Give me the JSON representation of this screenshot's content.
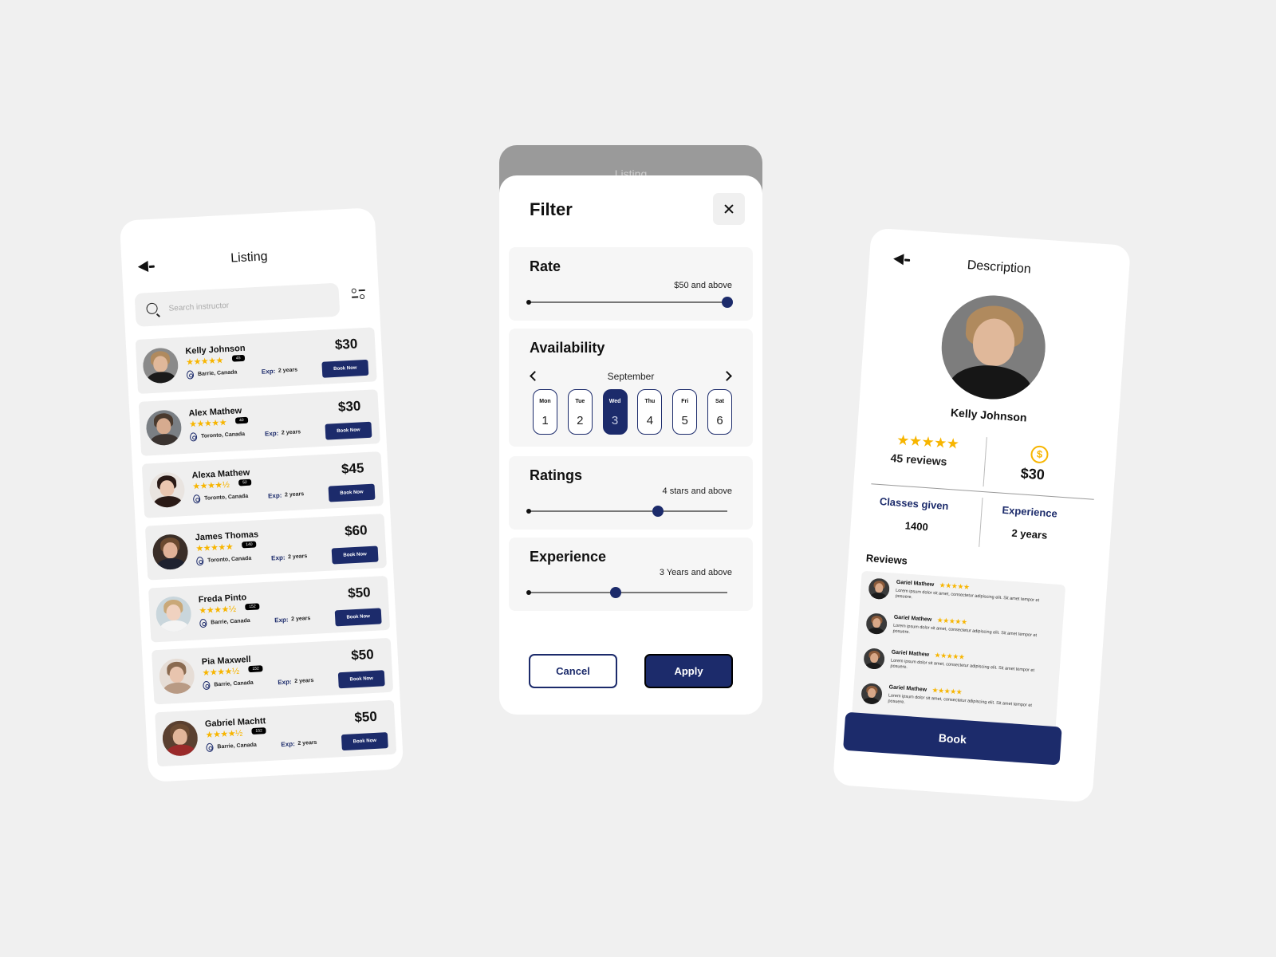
{
  "colors": {
    "brand_navy": "#1c2b6b",
    "star_yellow": "#f7b500",
    "background": "#f0f0f0"
  },
  "listing": {
    "title": "Listing",
    "back_icon": "back-arrow-icon",
    "search": {
      "placeholder": "Search instructor",
      "value": ""
    },
    "filter_icon": "filter-sliders-icon",
    "items": [
      {
        "name": "Kelly Johnson",
        "stars": "★★★★★",
        "rating": 5,
        "reviews": "45",
        "location": "Barrie, Canada",
        "exp_label": "Exp:",
        "exp": "2 years",
        "price": "$30",
        "button": "Book Now"
      },
      {
        "name": "Alex Mathew",
        "stars": "★★★★★",
        "rating": 5,
        "reviews": "40",
        "location": "Toronto, Canada",
        "exp_label": "Exp:",
        "exp": "2 years",
        "price": "$30",
        "button": "Book Now"
      },
      {
        "name": "Alexa Mathew",
        "stars": "★★★★½",
        "rating": 4.5,
        "reviews": "52",
        "location": "Toronto, Canada",
        "exp_label": "Exp:",
        "exp": "2 years",
        "price": "$45",
        "button": "Book Now"
      },
      {
        "name": "James Thomas",
        "stars": "★★★★★",
        "rating": 5,
        "reviews": "140",
        "location": "Toronto, Canada",
        "exp_label": "Exp:",
        "exp": "2 years",
        "price": "$60",
        "button": "Book Now"
      },
      {
        "name": "Freda Pinto",
        "stars": "★★★★½",
        "rating": 4.5,
        "reviews": "152",
        "location": "Barrie, Canada",
        "exp_label": "Exp:",
        "exp": "2 years",
        "price": "$50",
        "button": "Book Now"
      },
      {
        "name": "Pia Maxwell",
        "stars": "★★★★½",
        "rating": 4.5,
        "reviews": "152",
        "location": "Barrie, Canada",
        "exp_label": "Exp:",
        "exp": "2 years",
        "price": "$50",
        "button": "Book Now"
      },
      {
        "name": "Gabriel Machtt",
        "stars": "★★★★½",
        "rating": 4.5,
        "reviews": "152",
        "location": "Barrie, Canada",
        "exp_label": "Exp:",
        "exp": "2 years",
        "price": "$50",
        "button": "Book Now"
      }
    ]
  },
  "filter": {
    "behind_title": "Listing",
    "title": "Filter",
    "close_icon": "close-x-icon",
    "rate": {
      "label": "Rate",
      "caption": "$50 and above",
      "value_fraction": 1.0
    },
    "availability": {
      "label": "Availability",
      "month": "September",
      "days": [
        {
          "name": "Mon",
          "date": "1",
          "selected": false
        },
        {
          "name": "Tue",
          "date": "2",
          "selected": false
        },
        {
          "name": "Wed",
          "date": "3",
          "selected": true
        },
        {
          "name": "Thu",
          "date": "4",
          "selected": false
        },
        {
          "name": "Fri",
          "date": "5",
          "selected": false
        },
        {
          "name": "Sat",
          "date": "6",
          "selected": false
        }
      ]
    },
    "ratings": {
      "label": "Ratings",
      "caption": "4 stars and above",
      "value_fraction": 0.65
    },
    "experience": {
      "label": "Experience",
      "caption": "3 Years and above",
      "value_fraction": 0.44
    },
    "cancel_label": "Cancel",
    "apply_label": "Apply"
  },
  "description": {
    "title": "Description",
    "name": "Kelly Johnson",
    "stars": "★★★★★",
    "reviews_count": "45 reviews",
    "price": "$30",
    "classes_label": "Classes given",
    "classes_value": "1400",
    "experience_label": "Experience",
    "experience_value": "2 years",
    "reviews_title": "Reviews",
    "reviews": [
      {
        "name": "Gariel Mathew",
        "stars": "★★★★★",
        "text": "Lorem ipsum dolor sit amet, consectetur adipiscing elit. Sit amet tempor et posuere."
      },
      {
        "name": "Gariel Mathew",
        "stars": "★★★★★",
        "text": "Lorem ipsum dolor sit amet, consectetur adipiscing elit. Sit amet tempor et posuere."
      },
      {
        "name": "Gariel Mathew",
        "stars": "★★★★★",
        "text": "Lorem ipsum dolor sit amet, consectetur adipiscing elit. Sit amet tempor et posuere."
      },
      {
        "name": "Gariel Mathew",
        "stars": "★★★★★",
        "text": "Lorem ipsum dolor sit amet, consectetur adipiscing elit. Sit amet tempor et posuere."
      }
    ],
    "book_label": "Book"
  }
}
